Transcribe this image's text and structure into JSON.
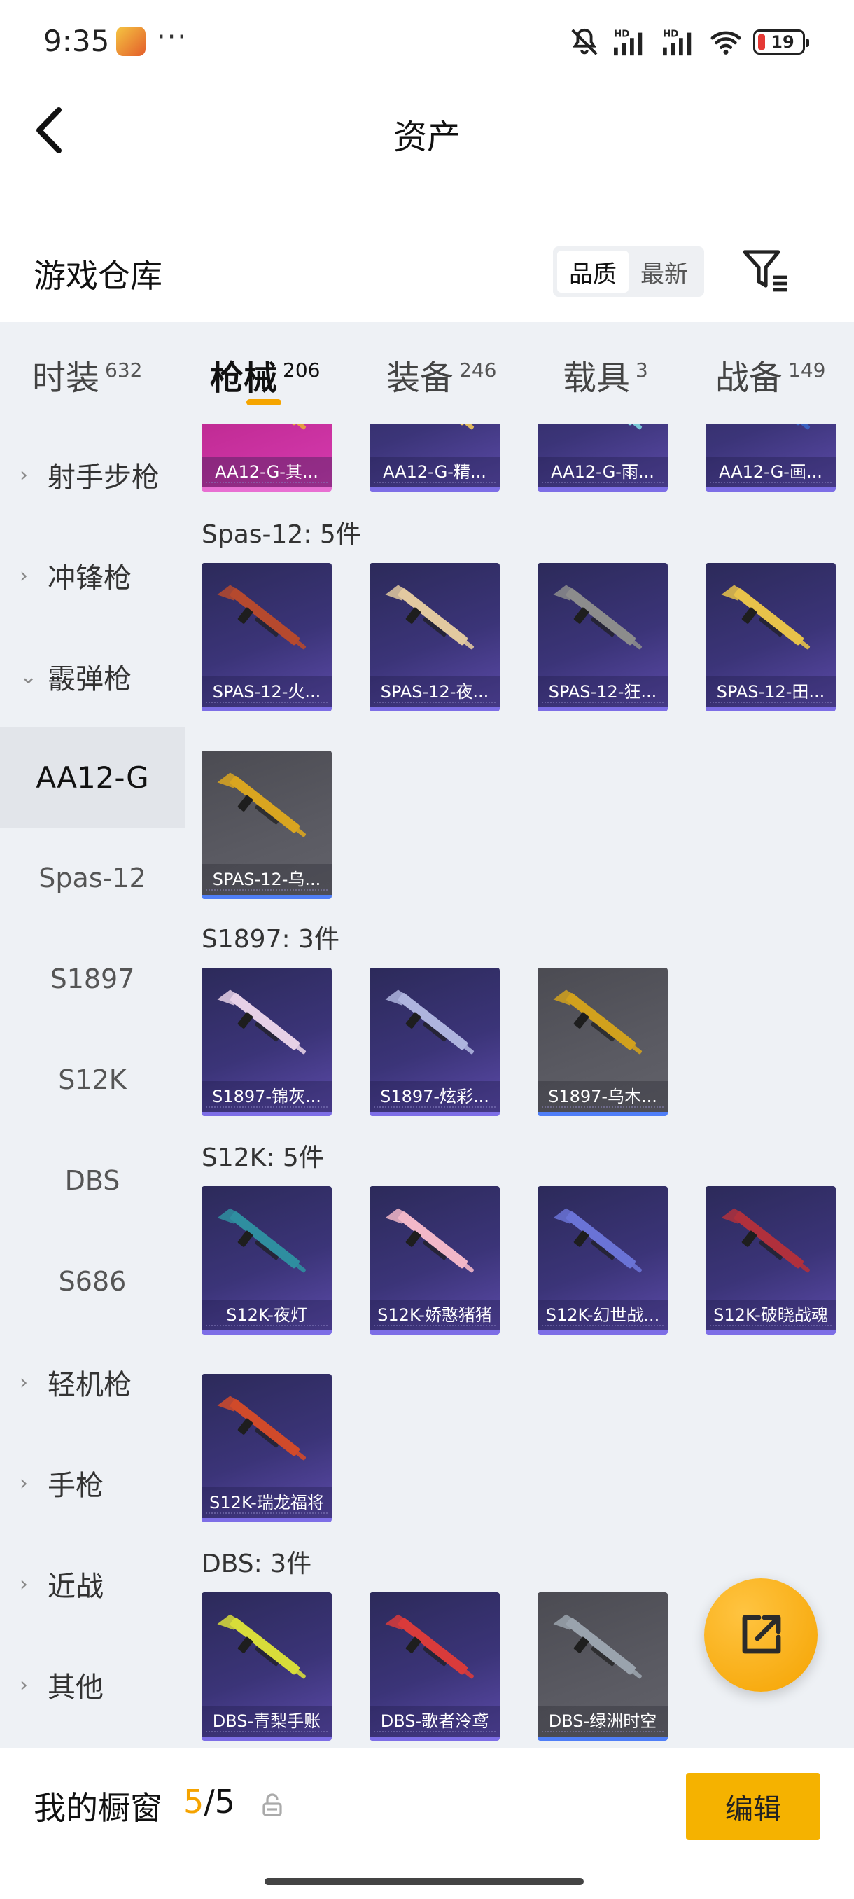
{
  "status_bar": {
    "time": "9:35",
    "dots": "···",
    "battery": "19",
    "icons": [
      "app-icon",
      "mute-icon",
      "signal-hd-icon",
      "signal-hd-icon",
      "wifi-icon",
      "battery-icon"
    ]
  },
  "header": {
    "title": "资产",
    "back_icon": "chevron-left-icon"
  },
  "warehouse": {
    "title": "游戏仓库",
    "sort_options": [
      "品质",
      "最新"
    ],
    "sort_active": "品质",
    "filter_icon": "filter-icon"
  },
  "tabs": [
    {
      "label": "时装",
      "count": "632"
    },
    {
      "label": "枪械",
      "count": "206",
      "active": true
    },
    {
      "label": "装备",
      "count": "246"
    },
    {
      "label": "载具",
      "count": "3"
    },
    {
      "label": "战备",
      "count": "149"
    }
  ],
  "sidebar": {
    "items": [
      {
        "label": "射手步枪",
        "type": "category",
        "chevron": "›"
      },
      {
        "label": "冲锋枪",
        "type": "category",
        "chevron": "›"
      },
      {
        "label": "霰弹枪",
        "type": "category",
        "chevron": "⌄",
        "expanded": true
      },
      {
        "label": "AA12-G",
        "type": "sub",
        "active": true
      },
      {
        "label": "Spas-12",
        "type": "sub"
      },
      {
        "label": "S1897",
        "type": "sub"
      },
      {
        "label": "S12K",
        "type": "sub"
      },
      {
        "label": "DBS",
        "type": "sub"
      },
      {
        "label": "S686",
        "type": "sub"
      },
      {
        "label": "轻机枪",
        "type": "category",
        "chevron": "›"
      },
      {
        "label": "手枪",
        "type": "category",
        "chevron": "›"
      },
      {
        "label": "近战",
        "type": "category",
        "chevron": "›"
      },
      {
        "label": "其他",
        "type": "category",
        "chevron": "›"
      }
    ]
  },
  "groups": [
    {
      "label": "",
      "items": [
        {
          "name": "AA12-G-其...",
          "style": "pink",
          "gun_color": "#e8a93a"
        },
        {
          "name": "AA12-G-精...",
          "style": "purple",
          "gun_color": "#f0c85a"
        },
        {
          "name": "AA12-G-雨...",
          "style": "purple",
          "gun_color": "#7ed7e0"
        },
        {
          "name": "AA12-G-画...",
          "style": "purple",
          "gun_color": "#3a66c8"
        }
      ]
    },
    {
      "label": "Spas-12: 5件",
      "items": [
        {
          "name": "SPAS-12-火...",
          "style": "purple",
          "gun_color": "#b5492e"
        },
        {
          "name": "SPAS-12-夜...",
          "style": "purple",
          "gun_color": "#e2c9a0"
        },
        {
          "name": "SPAS-12-狂...",
          "style": "purple",
          "gun_color": "#8c8c8c"
        },
        {
          "name": "SPAS-12-田...",
          "style": "purple",
          "gun_color": "#e7c24a"
        },
        {
          "name": "SPAS-12-乌...",
          "style": "gray",
          "gun_color": "#d9a520"
        }
      ]
    },
    {
      "label": "S1897: 3件",
      "items": [
        {
          "name": "S1897-锦灰...",
          "style": "purple",
          "gun_color": "#e6d0e6"
        },
        {
          "name": "S1897-炫彩...",
          "style": "purple",
          "gun_color": "#aeb4de"
        },
        {
          "name": "S1897-乌木...",
          "style": "gray",
          "gun_color": "#d1a11d"
        }
      ]
    },
    {
      "label": "S12K: 5件",
      "items": [
        {
          "name": "S12K-夜灯",
          "style": "purple",
          "gun_color": "#2f8ea0"
        },
        {
          "name": "S12K-娇憨猪猪",
          "style": "purple",
          "gun_color": "#f2b7c8"
        },
        {
          "name": "S12K-幻世战...",
          "style": "purple",
          "gun_color": "#6a73d6"
        },
        {
          "name": "S12K-破晓战魂",
          "style": "purple",
          "gun_color": "#b0303c"
        },
        {
          "name": "S12K-瑞龙福将",
          "style": "purple",
          "gun_color": "#d04a2a"
        }
      ]
    },
    {
      "label": "DBS: 3件",
      "items": [
        {
          "name": "DBS-青梨手账",
          "style": "purple",
          "gun_color": "#d8dc3a"
        },
        {
          "name": "DBS-歌者泠鸢",
          "style": "purple",
          "gun_color": "#d93b3b"
        },
        {
          "name": "DBS-绿洲时空",
          "style": "gray",
          "gun_color": "#9aa3ad"
        }
      ]
    }
  ],
  "fab": {
    "icon": "share-external-icon"
  },
  "bottom_bar": {
    "title": "我的橱窗",
    "count_current": "5",
    "count_sep": "/",
    "count_total": "5",
    "lock_icon": "lock-icon",
    "edit_label": "编辑"
  }
}
